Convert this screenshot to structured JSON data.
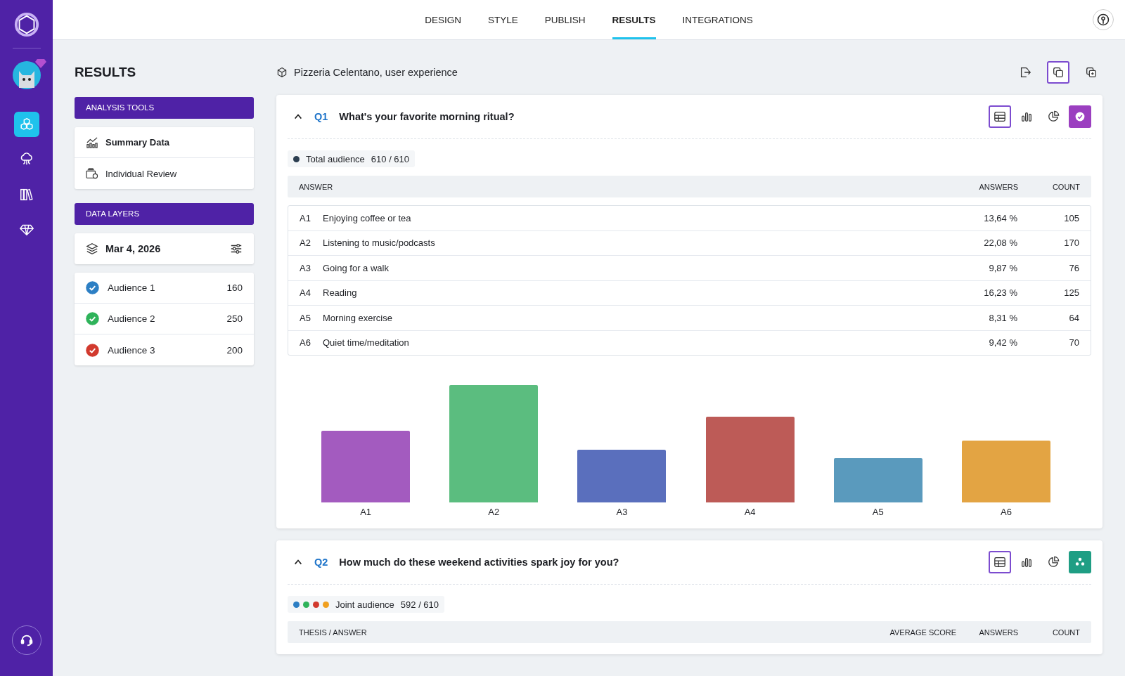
{
  "nav": {
    "items": [
      {
        "kind": "cubes",
        "selected": true
      },
      {
        "kind": "cloud",
        "selected": false
      },
      {
        "kind": "books",
        "selected": false
      },
      {
        "kind": "diamond",
        "selected": false
      }
    ]
  },
  "tabs": [
    {
      "label": "DESIGN",
      "selected": false
    },
    {
      "label": "STYLE",
      "selected": false
    },
    {
      "label": "PUBLISH",
      "selected": false
    },
    {
      "label": "RESULTS",
      "selected": true
    },
    {
      "label": "INTEGRATIONS",
      "selected": false
    }
  ],
  "page_title": "RESULTS",
  "analysis_tools": {
    "heading": "ANALYSIS TOOLS",
    "items": [
      {
        "label": "Summary Data",
        "kind": "chart",
        "selected": true
      },
      {
        "label": "Individual Review",
        "kind": "review",
        "selected": false
      }
    ]
  },
  "data_layers": {
    "heading": "DATA LAYERS",
    "date": "Mar 4, 2026",
    "audiences": [
      {
        "name": "Audience 1",
        "count": "160",
        "color": "#2d7fc4",
        "checked": true
      },
      {
        "name": "Audience 2",
        "count": "250",
        "color": "#2fb35a",
        "checked": true
      },
      {
        "name": "Audience 3",
        "count": "200",
        "color": "#d23a2e",
        "checked": true
      }
    ]
  },
  "project": {
    "title": "Pizzeria Celentano, user experience",
    "actions": [
      {
        "kind": "export",
        "selected": false
      },
      {
        "kind": "copy",
        "selected": true
      },
      {
        "kind": "duplicate",
        "selected": false
      }
    ]
  },
  "questions": [
    {
      "number": "Q1",
      "title": "What's your favorite morning ritual?",
      "expanded": true,
      "views": [
        {
          "kind": "table",
          "selected": true
        },
        {
          "kind": "bar",
          "selected": false
        },
        {
          "kind": "pie",
          "selected": false
        }
      ],
      "badge": {
        "kind": "check",
        "color": "#9b3fc0"
      },
      "audience": {
        "dots": [
          {
            "color": "#2c3e50"
          }
        ],
        "label": "Total audience",
        "value": "610 / 610"
      },
      "columns": [
        "ANSWER",
        "ANSWERS",
        "COUNT"
      ],
      "rows": [
        {
          "code": "A1",
          "answer": "Enjoying coffee or tea",
          "answers": "13,64 %",
          "count": "105"
        },
        {
          "code": "A2",
          "answer": "Listening to music/podcasts",
          "answers": "22,08 %",
          "count": "170"
        },
        {
          "code": "A3",
          "answer": "Going for a walk",
          "answers": "9,87 %",
          "count": "76"
        },
        {
          "code": "A4",
          "answer": "Reading",
          "answers": "16,23 %",
          "count": "125"
        },
        {
          "code": "A5",
          "answer": "Morning exercise",
          "answers": "8,31 %",
          "count": "64"
        },
        {
          "code": "A6",
          "answer": "Quiet time/meditation",
          "answers": "9,42 %",
          "count": "70"
        }
      ],
      "chart": {
        "bars": [
          {
            "label": "A1",
            "color": "#a35bbf"
          },
          {
            "label": "A2",
            "color": "#5bbd7f"
          },
          {
            "label": "A3",
            "color": "#5a6fbd"
          },
          {
            "label": "A4",
            "color": "#bd5b57"
          },
          {
            "label": "A5",
            "color": "#5a9abd"
          },
          {
            "label": "A6",
            "color": "#e3a443"
          }
        ]
      }
    },
    {
      "number": "Q2",
      "title": "How much do these weekend activities spark joy for you?",
      "expanded": true,
      "views": [
        {
          "kind": "table",
          "selected": true
        },
        {
          "kind": "bar",
          "selected": false
        },
        {
          "kind": "pie",
          "selected": false
        }
      ],
      "badge": {
        "kind": "stars",
        "color": "#1f9e84"
      },
      "audience": {
        "dots": [
          {
            "color": "#2d7fc4"
          },
          {
            "color": "#2fb35a"
          },
          {
            "color": "#d23a2e"
          },
          {
            "color": "#f0a020"
          }
        ],
        "label": "Joint audience",
        "value": "592 / 610"
      },
      "columns": [
        "THESIS / ANSWER",
        "AVERAGE SCORE",
        "ANSWERS",
        "COUNT"
      ]
    }
  ]
}
